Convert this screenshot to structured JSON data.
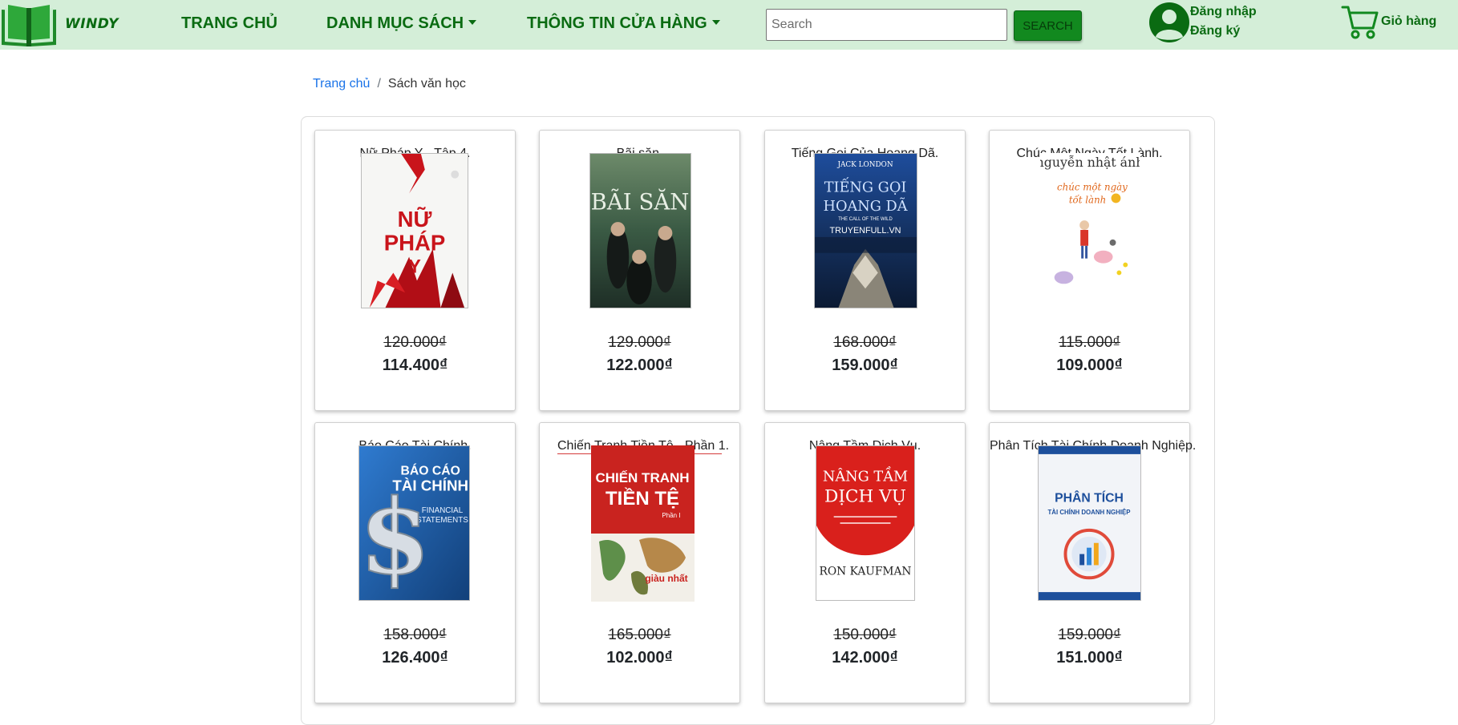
{
  "header": {
    "brand": "WINDY",
    "nav": {
      "home": "TRANG CHỦ",
      "categories": "DANH MỤC SÁCH",
      "store_info": "THÔNG TIN CỬA HÀNG"
    },
    "search": {
      "placeholder": "Search",
      "value": "",
      "button": "SEARCH"
    },
    "user": {
      "login": "Đăng nhập",
      "register": "Đăng ký"
    },
    "cart": {
      "label": "Giỏ hàng"
    }
  },
  "breadcrumb": {
    "home": "Trang chủ",
    "separator": "/",
    "current": "Sách văn học"
  },
  "products": [
    {
      "title": "Nữ Pháp Y - Tập 4.",
      "old_price": "120.000₫",
      "price": "114.400₫",
      "cover": {
        "line1": "NỮ",
        "line2": "PHÁP",
        "line3": "Y",
        "author": ""
      }
    },
    {
      "title": "Bãi săn.",
      "old_price": "129.000₫",
      "price": "122.000₫",
      "cover": {
        "line1": "BÃI SĂN",
        "author": ""
      }
    },
    {
      "title": "Tiếng Gọi Của Hoang Dã.",
      "old_price": "168.000₫",
      "price": "159.000₫",
      "cover": {
        "author": "JACK LONDON",
        "line1": "TIẾNG GỌI",
        "line2": "HOANG DÃ",
        "line3": "THE CALL OF THE WILD",
        "line4": "TRUYENFULL.VN"
      }
    },
    {
      "title": "Chúc Một Ngày Tốt Lành.",
      "old_price": "115.000₫",
      "price": "109.000₫",
      "cover": {
        "author": "nguyễn nhật ánh",
        "line1": "chúc một ngày",
        "line2": "tốt lành"
      }
    },
    {
      "title": "Báo Cáo Tài Chính.",
      "old_price": "158.000₫",
      "price": "126.400₫",
      "cover": {
        "line1": "BÁO CÁO",
        "line2": "TÀI CHÍNH",
        "line3": "FINANCIAL",
        "line4": "STATEMENTS"
      }
    },
    {
      "title": "Chiến Tranh Tiền Tệ - Phần 1.",
      "old_price": "165.000₫",
      "price": "102.000₫",
      "cover": {
        "line1": "CHIẾN TRANH",
        "line2": "TIỀN TỆ",
        "line3": "Phần I"
      }
    },
    {
      "title": "Nâng Tầm Dịch Vụ.",
      "old_price": "150.000₫",
      "price": "142.000₫",
      "cover": {
        "line1": "NÂNG TẦM",
        "line2": "DỊCH VỤ",
        "author": "RON KAUFMAN"
      }
    },
    {
      "title": "Phân Tích Tài Chính Doanh Nghiệp.",
      "old_price": "159.000₫",
      "price": "151.000₫",
      "cover": {
        "line1": "PHÂN TÍCH",
        "line2": "TÀI CHÍNH DOANH NGHIỆP"
      }
    }
  ],
  "colors": {
    "nav_bg": "#d4eed8",
    "nav_text": "#0a6b12",
    "search_button": "#12891f",
    "link": "#1a73e8"
  },
  "icons": {
    "logo": "open-book-icon",
    "user": "user-avatar-icon",
    "cart": "shopping-cart-icon",
    "dropdown": "caret-down-icon"
  }
}
